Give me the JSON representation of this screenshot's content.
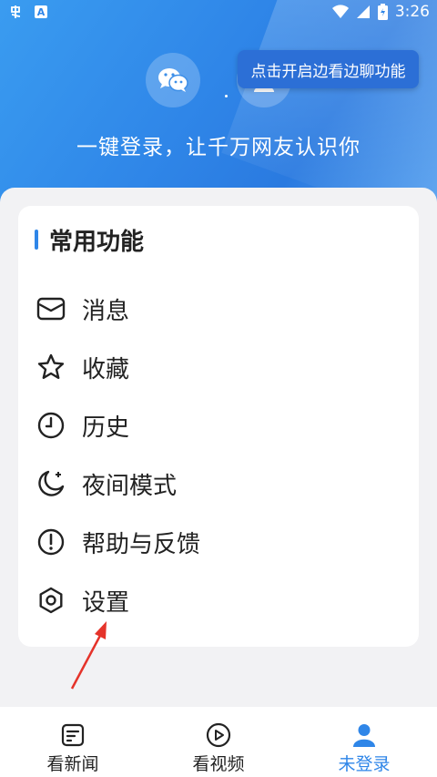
{
  "status_bar": {
    "time": "3:26",
    "notif_letter": "A"
  },
  "header": {
    "tooltip": "点击开启边看边聊功能",
    "slogan": "一键登录，让千万网友认识你",
    "login_options": [
      {
        "icon": "wechat-icon"
      },
      {
        "icon": "user-icon"
      }
    ]
  },
  "card": {
    "title": "常用功能",
    "items": [
      {
        "label": "消息",
        "icon": "mail-icon"
      },
      {
        "label": "收藏",
        "icon": "star-icon"
      },
      {
        "label": "历史",
        "icon": "clock-icon"
      },
      {
        "label": "夜间模式",
        "icon": "moon-icon"
      },
      {
        "label": "帮助与反馈",
        "icon": "help-icon"
      },
      {
        "label": "设置",
        "icon": "settings-icon"
      }
    ]
  },
  "tabs": [
    {
      "label": "看新闻",
      "icon": "news-icon",
      "active": false
    },
    {
      "label": "看视频",
      "icon": "video-icon",
      "active": false
    },
    {
      "label": "未登录",
      "icon": "profile-icon",
      "active": true
    }
  ],
  "colors": {
    "accent": "#2f86e8",
    "tooltip_bg": "#2c6fd6",
    "annotation": "#e5332a"
  }
}
